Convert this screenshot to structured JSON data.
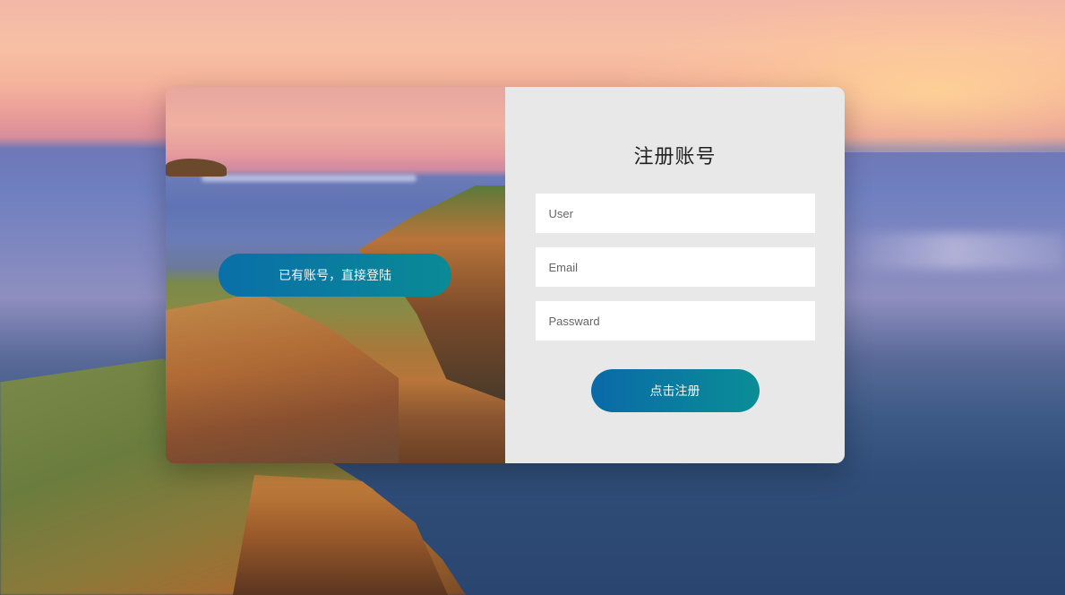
{
  "colors": {
    "accent_start": "#0a6fa8",
    "accent_end": "#0a8a96",
    "form_panel_bg": "#e8e8e8",
    "input_bg": "#ffffff"
  },
  "left_panel": {
    "login_button_label": "已有账号，直接登陆"
  },
  "form": {
    "title": "注册账号",
    "user_placeholder": "User",
    "email_placeholder": "Email",
    "password_placeholder": "Passward",
    "submit_label": "点击注册"
  }
}
